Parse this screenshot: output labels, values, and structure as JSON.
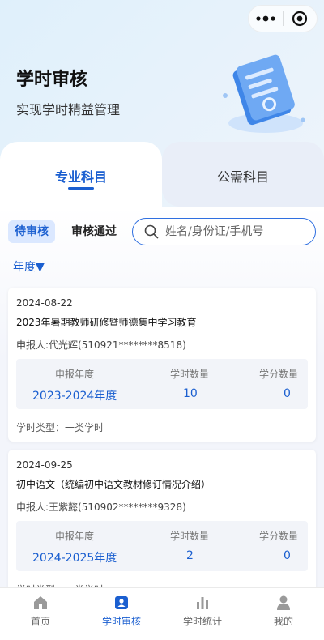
{
  "header": {
    "title": "学时审核",
    "subtitle": "实现学时精益管理"
  },
  "tabs": [
    {
      "label": "专业科目",
      "active": true
    },
    {
      "label": "公需科目",
      "active": false
    }
  ],
  "filters": {
    "status_active": "待审核",
    "status_other": "审核通过",
    "search_placeholder": "姓名/身份证/手机号",
    "year_filter": "年度▼"
  },
  "records": [
    {
      "date": "2024-08-22",
      "title": "2023年暑期教师研修暨师德集中学习教育",
      "applicant": "申报人:代光辉(510921********8518)",
      "year_label": "申报年度",
      "year": "2023-2024年度",
      "hours_label": "学时数量",
      "hours": "10",
      "credits_label": "学分数量",
      "credits": "0",
      "type": "学时类型：一类学时"
    },
    {
      "date": "2024-09-25",
      "title": "初中语文（统编初中语文教材修订情况介绍）",
      "applicant": "申报人:王紫懿(510902********9328)",
      "year_label": "申报年度",
      "year": "2024-2025年度",
      "hours_label": "学时数量",
      "hours": "2",
      "credits_label": "学分数量",
      "credits": "0",
      "type": "学时类型：一类学时"
    }
  ],
  "nav": [
    {
      "label": "首页",
      "icon": "home-icon",
      "active": false
    },
    {
      "label": "学时审核",
      "icon": "review-icon",
      "active": true
    },
    {
      "label": "学时统计",
      "icon": "bar-chart-icon",
      "active": false
    },
    {
      "label": "我的",
      "icon": "user-icon",
      "active": false
    }
  ],
  "colors": {
    "accent": "#1b5fd0",
    "chip_bg": "#dbe8ff",
    "inactive_nav": "#666666"
  }
}
